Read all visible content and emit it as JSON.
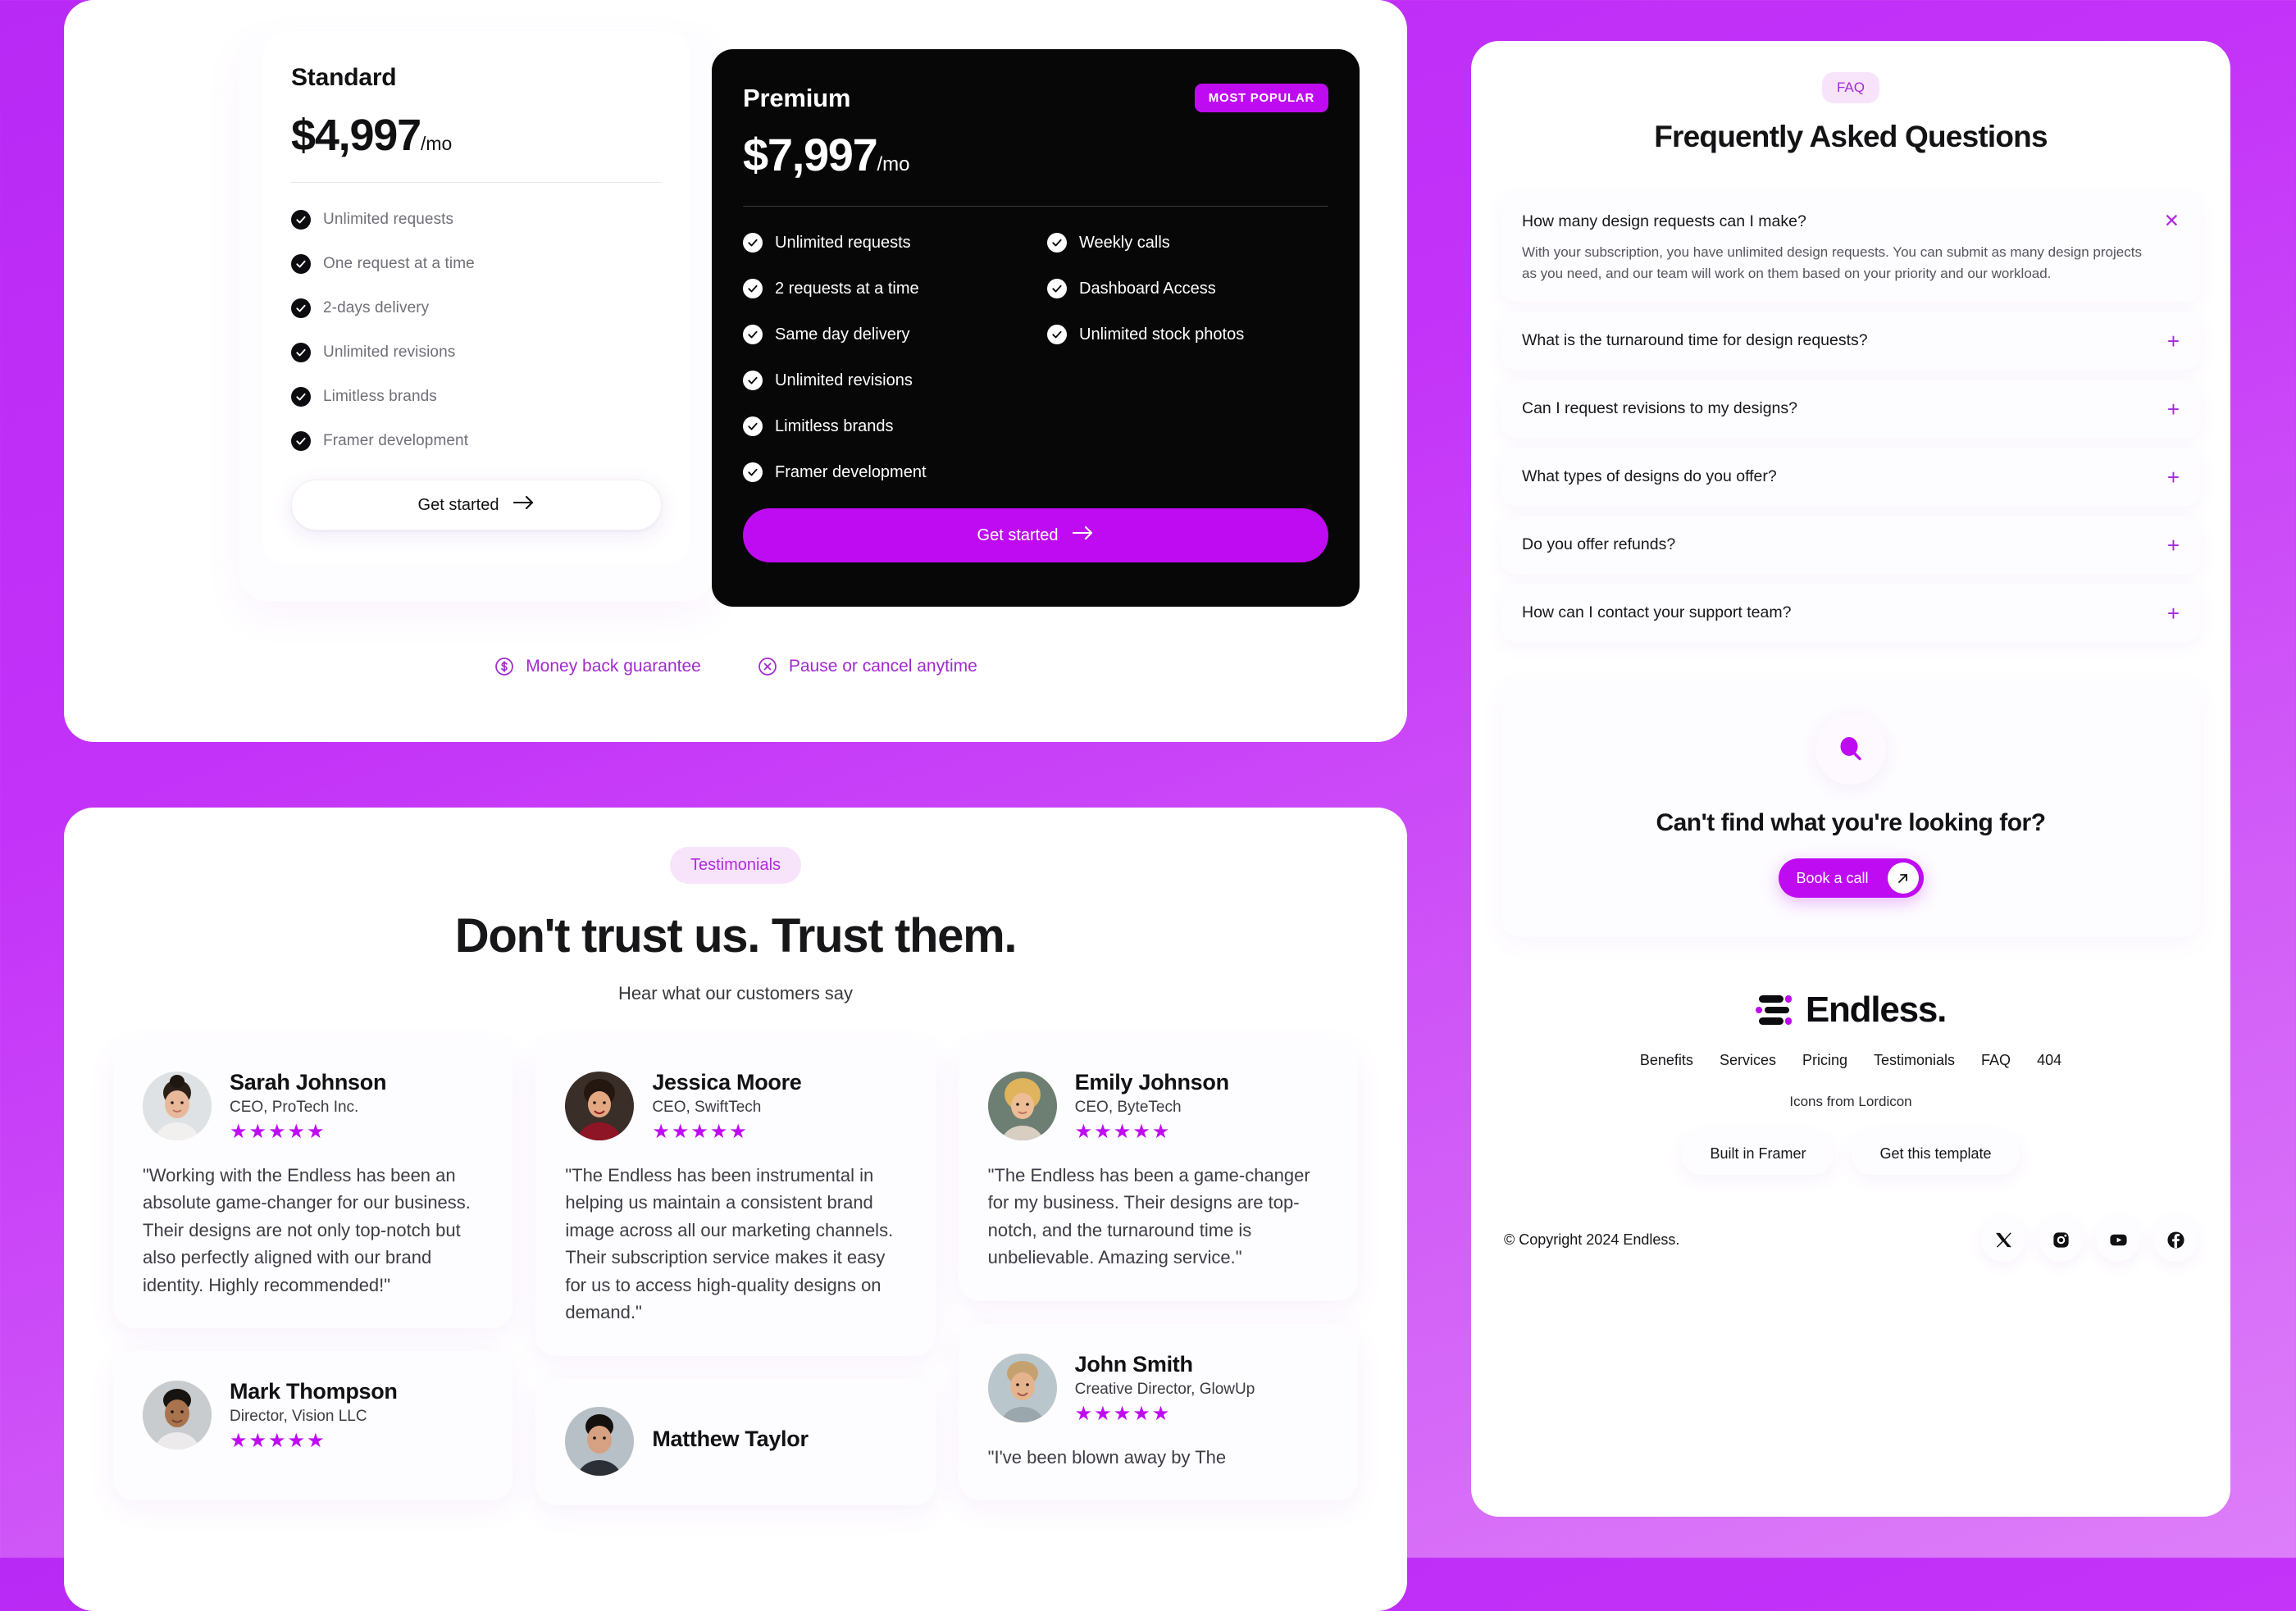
{
  "brand": {
    "accent": "#bf0bf2",
    "chip_bg": "#f7e4fb",
    "dark": "#0c0c10"
  },
  "pricing": {
    "standard": {
      "title": "Standard",
      "price": "$4,997",
      "price_suffix": "/mo",
      "features": [
        "Unlimited requests",
        "One request at a time",
        "2-days delivery",
        "Unlimited revisions",
        "Limitless brands",
        "Framer development"
      ],
      "cta": "Get started"
    },
    "premium": {
      "title": "Premium",
      "badge": "MOST POPULAR",
      "price": "$7,997",
      "price_suffix": "/mo",
      "features_left": [
        "Unlimited requests",
        "2 requests at a time",
        "Same day delivery",
        "Unlimited revisions",
        "Limitless brands",
        "Framer development"
      ],
      "features_right": [
        "Weekly calls",
        "Dashboard Access",
        "Unlimited stock photos"
      ],
      "cta": "Get started"
    },
    "guarantees": [
      {
        "icon": "dollar-circle-icon",
        "label": "Money back guarantee"
      },
      {
        "icon": "x-circle-icon",
        "label": "Pause or cancel anytime"
      }
    ]
  },
  "testimonials": {
    "chip": "Testimonials",
    "heading": "Don't trust us. Trust them.",
    "subheading": "Hear what our customers say",
    "stars": "★★★★★",
    "column1": [
      {
        "name": "Sarah Johnson",
        "role": "CEO, ProTech Inc.",
        "quote": "\"Working with the Endless has been an absolute game-changer for our business. Their designs are not only top-notch but also perfectly aligned with our brand identity. Highly recommended!\""
      },
      {
        "name": "Mark Thompson",
        "role": "Director, Vision LLC",
        "quote": ""
      }
    ],
    "column2": [
      {
        "name": "Jessica Moore",
        "role": "CEO, SwiftTech",
        "quote": "\"The Endless has been instrumental in helping us maintain a consistent brand image across all our marketing channels. Their subscription service makes it easy for us to access high-quality designs on demand.\""
      },
      {
        "name": "Matthew Taylor",
        "role": "",
        "quote": ""
      }
    ],
    "column3": [
      {
        "name": "Emily Johnson",
        "role": "CEO, ByteTech",
        "quote": "\"The Endless has been a game-changer for my business. Their designs are top-notch, and the turnaround time is unbelievable. Amazing service.\""
      },
      {
        "name": "John Smith",
        "role": "Creative Director, GlowUp",
        "quote": "\"I've been blown away by The"
      }
    ]
  },
  "faq": {
    "chip": "FAQ",
    "heading": "Frequently Asked Questions",
    "items": [
      {
        "question": "How many design requests can I make?",
        "answer": "With your subscription, you have unlimited design requests. You can submit as many design projects as you need, and our team will work on them based on your priority and our workload.",
        "open": true,
        "toggle": "✕"
      },
      {
        "question": "What is the turnaround time for design requests?",
        "answer": "",
        "open": false,
        "toggle": "+"
      },
      {
        "question": "Can I request revisions to my designs?",
        "answer": "",
        "open": false,
        "toggle": "+"
      },
      {
        "question": "What types of designs do you offer?",
        "answer": "",
        "open": false,
        "toggle": "+"
      },
      {
        "question": "Do you offer refunds?",
        "answer": "",
        "open": false,
        "toggle": "+"
      },
      {
        "question": "How can I contact your support team?",
        "answer": "",
        "open": false,
        "toggle": "+"
      }
    ],
    "cta": {
      "icon": "search-icon",
      "heading": "Can't find what you're looking for?",
      "button_label": "Book a call"
    }
  },
  "footer": {
    "logo_text": "Endless.",
    "nav": [
      "Benefits",
      "Services",
      "Pricing",
      "Testimonials",
      "FAQ",
      "404"
    ],
    "credit": "Icons from Lordicon",
    "buttons": [
      "Built in Framer",
      "Get this template"
    ],
    "copyright": "© Copyright 2024 Endless.",
    "socials": [
      "x-icon",
      "instagram-icon",
      "youtube-icon",
      "facebook-icon"
    ]
  }
}
